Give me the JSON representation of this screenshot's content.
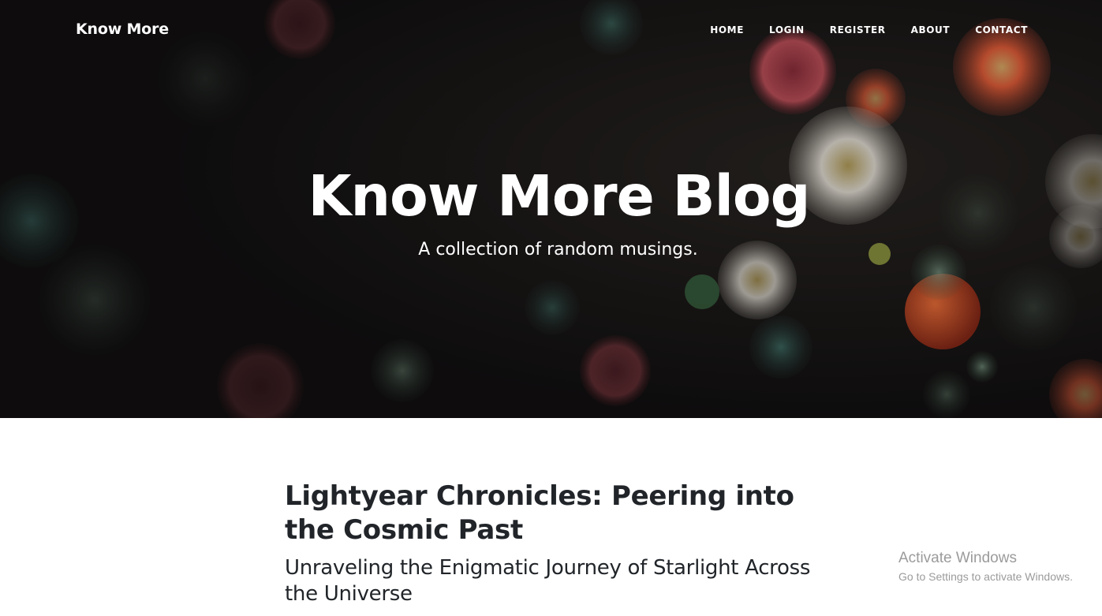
{
  "navbar": {
    "brand": "Know More",
    "links": [
      "HOME",
      "LOGIN",
      "REGISTER",
      "ABOUT",
      "CONTACT"
    ]
  },
  "hero": {
    "title": "Know More Blog",
    "subtitle": "A collection of random musings."
  },
  "post": {
    "title": "Lightyear Chronicles: Peering into the Cosmic Past",
    "subtitle": "Unraveling the Enigmatic Journey of Starlight Across the Universe"
  },
  "watermark": {
    "title": "Activate Windows",
    "subtitle": "Go to Settings to activate Windows."
  }
}
